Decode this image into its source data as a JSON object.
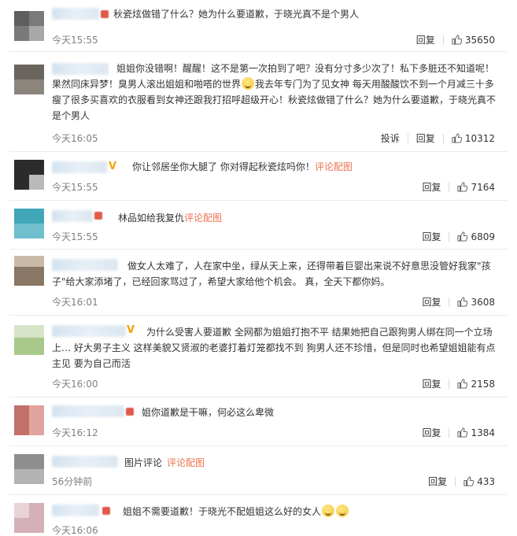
{
  "labels": {
    "reply": "回复",
    "report": "投诉"
  },
  "comments": [
    {
      "text": "秋瓷炫做错了什么？她为什么要道歉，于晓光真不是个男人",
      "time": "今天15:55",
      "likes": "35650"
    },
    {
      "text_a": "姐姐你没错啊！醒醒！这不是第一次拍到了吧？没有分寸多少次了！私下多脏还不知道呢！果然同床异梦！臭男人滚出姐姐和啪嗒的世界",
      "text_b": "我去年专门为了见女神 每天用酸酸饮不到一个月减三十多瘦了很多买喜欢的衣服看到女神还跟我打招呼超级开心！秋瓷炫做错了什么？她为什么要道歉，于晓光真不是个男人",
      "time": "今天16:05",
      "likes": "10312"
    },
    {
      "text": "你让邻居坐你大腿了 你对得起秋瓷炫吗你！",
      "link": "评论配图",
      "time": "今天15:55",
      "likes": "7164"
    },
    {
      "text": "林品如给我复仇",
      "link": "评论配图",
      "time": "今天15:55",
      "likes": "6809"
    },
    {
      "text": "做女人太难了，人在家中坐，绿从天上来，还得带着巨婴出来说不好意思没管好我家\"孩子\"给大家添堵了，已经回家骂过了，希望大家给他个机会。 真，全天下都你妈。",
      "time": "今天16:01",
      "likes": "3608"
    },
    {
      "text": "为什么受害人要道歉 全网都为姐姐打抱不平 结果她把自己跟狗男人绑在同一个立场上… 好大男子主义 这样美貌又贤淑的老婆打着灯笼都找不到 狗男人还不珍惜，但是同时也希望姐姐能有点主见 要为自己而活",
      "time": "今天16:00",
      "likes": "2158"
    },
    {
      "text": "姐你道歉是干嘛，何必这么卑微",
      "time": "今天16:12",
      "likes": "1384"
    },
    {
      "text": "图片评论",
      "link": "评论配图",
      "time": "56分钟前",
      "likes": "433"
    },
    {
      "text": "姐姐不需要道歉！于晓光不配姐姐这么好的女人",
      "time": "今天16:06",
      "likes": ""
    }
  ],
  "colors": {
    "link": "#eb7350",
    "time": "#808080",
    "vip_badge": "#f3a300"
  },
  "icons": {
    "like": "thumbs-up-icon",
    "emoji": "smiling-face-emoji"
  }
}
